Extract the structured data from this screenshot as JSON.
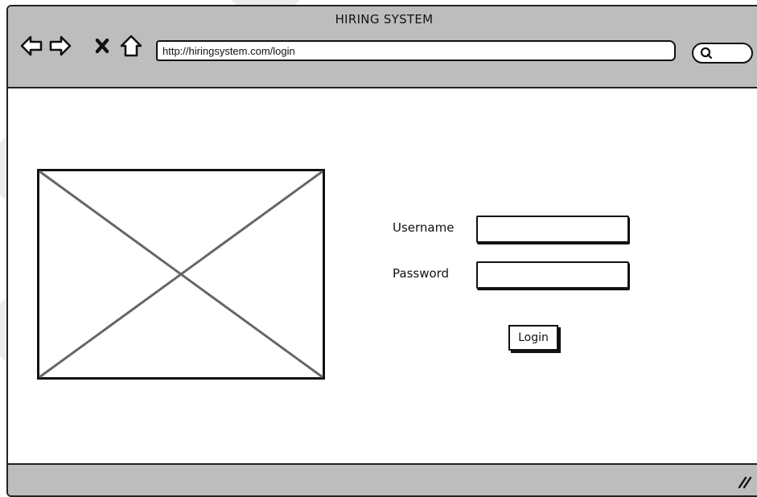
{
  "window": {
    "title": "HIRING SYSTEM"
  },
  "toolbar": {
    "url": "http://hiringsystem.com/login",
    "icons": [
      "back-arrow-icon",
      "forward-arrow-icon",
      "close-icon",
      "home-icon",
      "search-icon"
    ]
  },
  "login_form": {
    "username_label": "Username",
    "password_label": "Password",
    "username_value": "",
    "password_value": "",
    "login_label": "Login"
  },
  "colors": {
    "chrome": "#bdbdbd",
    "ink": "#111111",
    "placeholder_lines": "#666666"
  }
}
